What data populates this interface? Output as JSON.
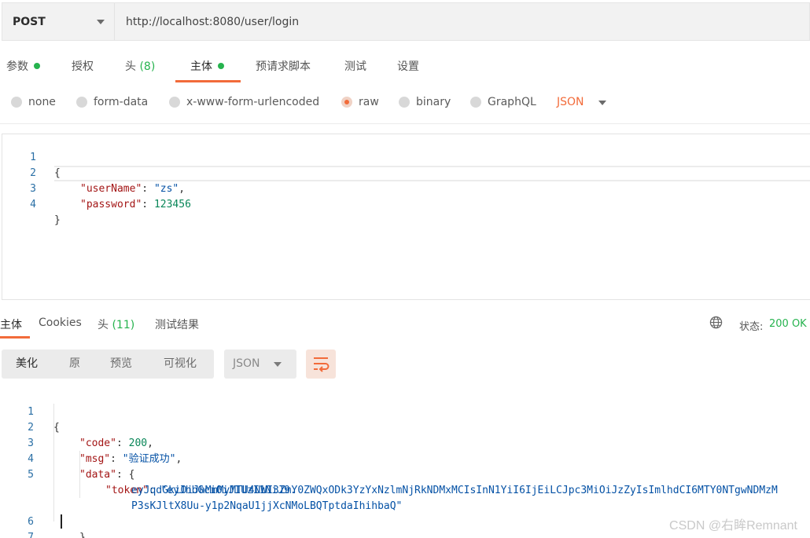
{
  "request": {
    "method": "POST",
    "url": "http://localhost:8080/user/login"
  },
  "request_tabs": [
    {
      "label": "参数",
      "dot": true
    },
    {
      "label": "授权"
    },
    {
      "label": "头",
      "count": "(8)"
    },
    {
      "label": "主体",
      "dot": true,
      "active": true
    },
    {
      "label": "预请求脚本"
    },
    {
      "label": "测试"
    },
    {
      "label": "设置"
    }
  ],
  "body_types": [
    {
      "label": "none"
    },
    {
      "label": "form-data"
    },
    {
      "label": "x-www-form-urlencoded"
    },
    {
      "label": "raw",
      "selected": true
    },
    {
      "label": "binary"
    },
    {
      "label": "GraphQL"
    }
  ],
  "body_language": "JSON",
  "request_body": {
    "line_numbers": [
      "1",
      "2",
      "3",
      "4"
    ],
    "open_brace": "{",
    "close_brace": "}",
    "k1": "\"userName\"",
    "v1": "\"zs\"",
    "k2": "\"password\"",
    "v2": "123456"
  },
  "response_tabs": {
    "body": "主体",
    "cookies": "Cookies",
    "headers": "头",
    "headers_count": "(11)",
    "tests": "测试结果"
  },
  "status": {
    "label": "状态:",
    "value": "200 OK"
  },
  "response_views": [
    "美化",
    "原",
    "预览",
    "可视化"
  ],
  "response_format": "JSON",
  "response_body": {
    "line_numbers": [
      "1",
      "2",
      "3",
      "4",
      "5",
      "",
      "",
      "6",
      "7"
    ],
    "open_brace": "{",
    "close_brace": "}",
    "k_code": "\"code\"",
    "v_code": "200",
    "k_msg": "\"msg\"",
    "v_msg": "\"验证成功\"",
    "k_data": "\"data\"",
    "k_token": "\"token\"",
    "token_1": "\"eyJhbGciOiJIUzI1NiJ9.",
    "token_2": "eyJqdGkiOiJhMmMyMTU4NWI3ZmY0ZWQxODk3YzYxNzlmNjRkNDMxMCIsInN1YiI6IjEiLCJpc3MiOiJzZyIsImlhdCI6MTY0NTgwNDMzM",
    "token_3": "P3sKJltX8Uu-y1p2NqaU1jjXcNMoLBQTptdaIhihbaQ\"",
    "close_inner": "}"
  },
  "watermark": "CSDN @右眸Remnant"
}
